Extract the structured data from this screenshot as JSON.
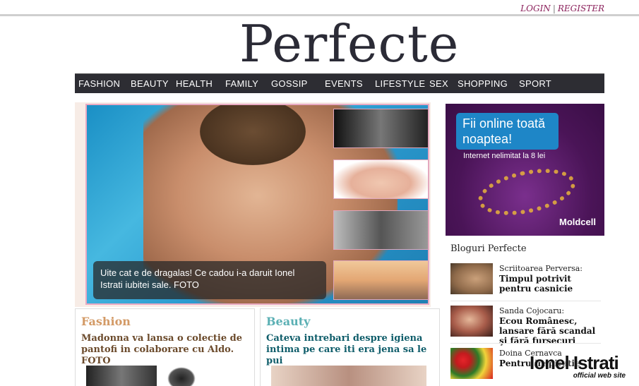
{
  "header": {
    "login_label": "LOGIN",
    "separator": "|",
    "register_label": "REGISTER",
    "logo_text": "Perfecte"
  },
  "nav": {
    "items": [
      "FASHION",
      "BEAUTY",
      "HEALTH",
      "FAMILY",
      "GOSSIP",
      "EVENTS",
      "LIFESTYLE",
      "SEX",
      "SHOPPING",
      "SPORT"
    ]
  },
  "feature": {
    "caption": "Uite cat e de dragalas! Ce cadou i-a daruit Ionel Istrati iubitei sale. FOTO"
  },
  "ad": {
    "headline": "Fii online toată noaptea!",
    "subline": "Internet nelimitat la 8 lei",
    "brand": "Moldcell"
  },
  "blogs": {
    "title": "Bloguri Perfecte",
    "items": [
      {
        "author": "Scriitoarea Perversa:",
        "title": "Timpul potrivit pentru casnicie"
      },
      {
        "author": "Sanda Cojocaru:",
        "title": "Ecou Românesc, lansare fără scandal şi fără fursecuri"
      },
      {
        "author": "Doina Cernavca",
        "title": "Pentru inspiratie"
      }
    ]
  },
  "cards": [
    {
      "category": "Fashion",
      "headline": "Madonna va lansa o colectie de pantofi in colaborare cu Aldo. FOTO"
    },
    {
      "category": "Beauty",
      "headline": "Cateva intrebari despre igiena intima pe care iti era jena sa le pui"
    }
  ],
  "watermark": {
    "name": "Ionel Istrati",
    "tagline": "official web site"
  },
  "colors": {
    "accent": "#8a1f5a",
    "nav_bg": "#2d2d33",
    "fashion": "#d39a66",
    "beauty": "#5bb0b4",
    "fashion_headline": "#6b4a2b",
    "beauty_headline": "#0f5d6a"
  }
}
